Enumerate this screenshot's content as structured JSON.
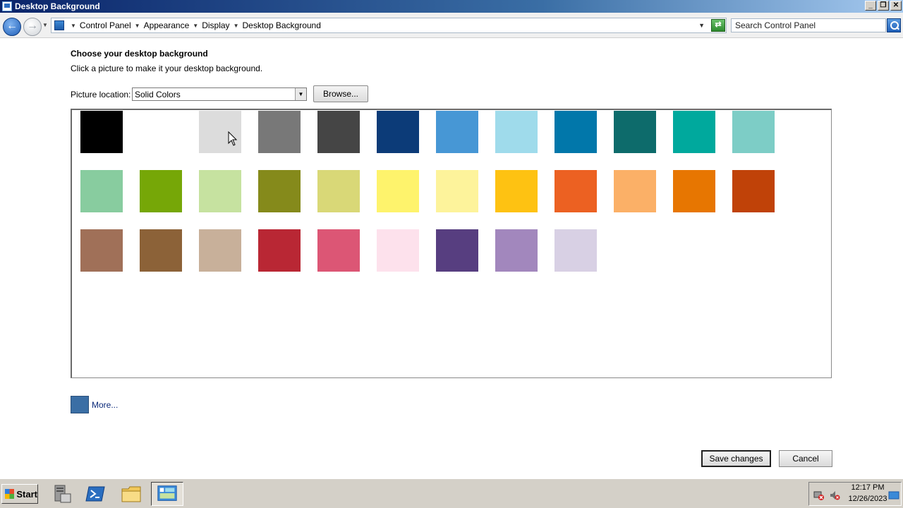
{
  "window": {
    "title": "Desktop Background"
  },
  "address": {
    "breadcrumbs": [
      "Control Panel",
      "Appearance",
      "Display",
      "Desktop Background"
    ],
    "search_placeholder": "Search Control Panel"
  },
  "content": {
    "heading": "Choose your desktop background",
    "subtext": "Click a picture to make it your desktop background.",
    "location_label": "Picture location:",
    "location_value": "Solid Colors",
    "browse_label": "Browse...",
    "more_label": "More...",
    "more_color": "#3a6ea5",
    "save_label": "Save changes",
    "cancel_label": "Cancel"
  },
  "swatches": [
    [
      "#000000",
      "#ffffff",
      "#dcdcdc",
      "#787878",
      "#454545",
      "#0c3b78",
      "#4797d5",
      "#9fdbeb",
      "#0177aa",
      "#0d6b6b",
      "#00a99d",
      "#7dcdc6"
    ],
    [
      "#88cc9f",
      "#76a707",
      "#c6e2a0",
      "#858a1b",
      "#d9d877",
      "#fef36c",
      "#fdf39b",
      "#fec212",
      "#ec6122",
      "#fbb067",
      "#e77601",
      "#c04208"
    ],
    [
      "#a07058",
      "#8c6238",
      "#c8b09a",
      "#b92734",
      "#dc5675",
      "#fde1ec",
      "#573e80",
      "#a287bd",
      "#d8d0e4"
    ]
  ],
  "taskbar": {
    "start_label": "Start",
    "time": "12:17 PM",
    "date": "12/26/2023"
  }
}
